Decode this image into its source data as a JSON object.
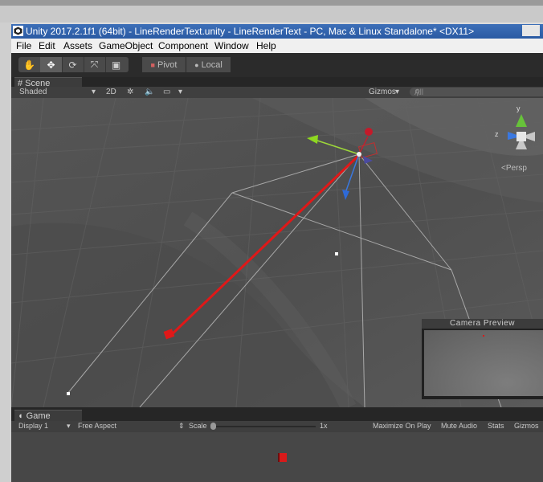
{
  "window": {
    "title": "Unity 2017.2.1f1 (64bit) - LineRenderText.unity - LineRenderText - PC, Mac & Linux Standalone* <DX11>"
  },
  "menu": [
    "File",
    "Edit",
    "Assets",
    "GameObject",
    "Component",
    "Window",
    "Help"
  ],
  "toolbar": {
    "tools": [
      "hand-icon",
      "move-icon",
      "rotate-icon",
      "scale-icon",
      "rect-icon"
    ],
    "selected_tool": "move",
    "pivot_label": "Pivot",
    "local_label": "Local"
  },
  "scene": {
    "tab_label": "Scene",
    "shading": "Shaded",
    "mode_2d": "2D",
    "gizmos_label": "Gizmos",
    "search_placeholder": "All",
    "persp_label": "Persp",
    "line_color": "#e01818"
  },
  "camera_preview": {
    "title": "Camera Preview"
  },
  "game": {
    "tab_label": "Game",
    "display": "Display 1",
    "aspect": "Free Aspect",
    "scale_label": "Scale",
    "scale_value": "1x",
    "maximize_label": "Maximize On Play",
    "mute_label": "Mute Audio",
    "stats_label": "Stats",
    "gizmos_label": "Gizmos"
  }
}
